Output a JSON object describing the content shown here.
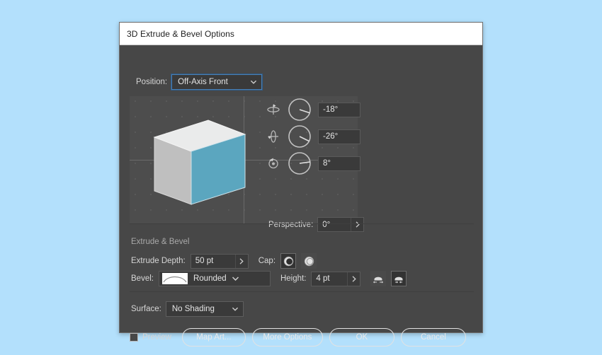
{
  "dialog": {
    "title": "3D Extrude & Bevel Options"
  },
  "position": {
    "label": "Position:",
    "value": "Off-Axis Front",
    "chevron_icon": "chevron-down-icon"
  },
  "preview": {
    "cube_front_color": "#5ba6bf",
    "cube_top_color": "#e9eaea",
    "cube_side_color": "#bdbdbd",
    "panel_color": "#4d4d4d"
  },
  "rotation": {
    "rows": [
      {
        "icon": "rotate-x-icon",
        "value": "-18°",
        "angle": -18
      },
      {
        "icon": "rotate-y-icon",
        "value": "-26°",
        "angle": -26
      },
      {
        "icon": "rotate-z-icon",
        "value": "8°",
        "angle": 8
      }
    ]
  },
  "perspective": {
    "label": "Perspective:",
    "value": "0°",
    "arrow_icon": "chevron-right-icon"
  },
  "extrude_bevel": {
    "section_title": "Extrude & Bevel",
    "depth_label": "Extrude Depth:",
    "depth_value": "50 pt",
    "depth_arrow_icon": "chevron-right-icon",
    "cap_label": "Cap:",
    "cap_buttons": [
      {
        "name": "cap-solid-button",
        "selected": true
      },
      {
        "name": "cap-hollow-button",
        "selected": false
      }
    ],
    "bevel_label": "Bevel:",
    "bevel_value": "Rounded",
    "bevel_chevron_icon": "chevron-down-icon",
    "height_label": "Height:",
    "height_value": "4 pt",
    "height_arrow_icon": "chevron-right-icon",
    "bevel_extent_buttons": [
      {
        "name": "bevel-extent-out-button",
        "selected": false
      },
      {
        "name": "bevel-extent-in-button",
        "selected": true
      }
    ]
  },
  "surface": {
    "label": "Surface:",
    "value": "No Shading",
    "chevron_icon": "chevron-down-icon"
  },
  "footer": {
    "preview_label": "Preview",
    "preview_checked": false,
    "map_art_label": "Map Art...",
    "more_options_label": "More Options",
    "ok_label": "OK",
    "cancel_label": "Cancel"
  }
}
